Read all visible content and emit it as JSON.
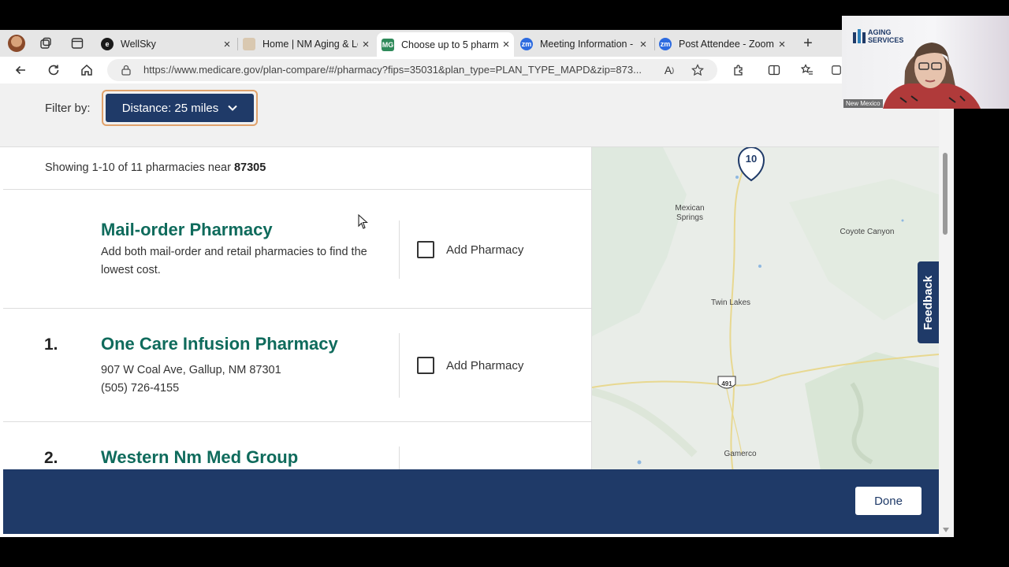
{
  "tabs": [
    {
      "title": "WellSky",
      "icon": "wellsky-icon"
    },
    {
      "title": "Home | NM Aging & Lo",
      "icon": "nm-aging-icon"
    },
    {
      "title": "Choose up to 5 pharma",
      "icon": "medicare-icon",
      "active": true
    },
    {
      "title": "Meeting Information - Z",
      "icon": "zoom-icon"
    },
    {
      "title": "Post Attendee - Zoom",
      "icon": "zoom-icon"
    }
  ],
  "tab_fav_text": {
    "medicare": "MG",
    "zoom": "zm",
    "wellsky": "e"
  },
  "address": {
    "url": "https://www.medicare.gov/plan-compare/#/pharmacy?fips=35031&plan_type=PLAN_TYPE_MAPD&zip=873..."
  },
  "filter": {
    "label": "Filter by:",
    "distance": "Distance: 25 miles"
  },
  "results": {
    "showing_prefix": "Showing 1-10 of 11 pharmacies near ",
    "zip": "87305",
    "mail_order": {
      "name": "Mail-order Pharmacy",
      "desc": "Add both mail-order and retail pharmacies to find the lowest cost.",
      "add_label": "Add Pharmacy"
    },
    "items": [
      {
        "num": "1.",
        "name": "One Care Infusion Pharmacy",
        "address": "907 W Coal Ave, Gallup, NM 87301",
        "phone": "(505) 726-4155",
        "add_label": "Add Pharmacy"
      },
      {
        "num": "2.",
        "name": "Western Nm Med Group"
      }
    ]
  },
  "map": {
    "marker": "10",
    "places": [
      "Mexican Springs",
      "Coyote Canyon",
      "Twin Lakes",
      "Gamerco"
    ],
    "route_shield": "491"
  },
  "feedback": "Feedback",
  "footer": {
    "done": "Done"
  },
  "webcam": {
    "logo_line1": "AGING",
    "logo_line2": "SERVICES",
    "name_tag": "New Mexico"
  },
  "colors": {
    "navy": "#1f3a68",
    "teal": "#0f6b5c",
    "focus": "#e0a26c"
  }
}
